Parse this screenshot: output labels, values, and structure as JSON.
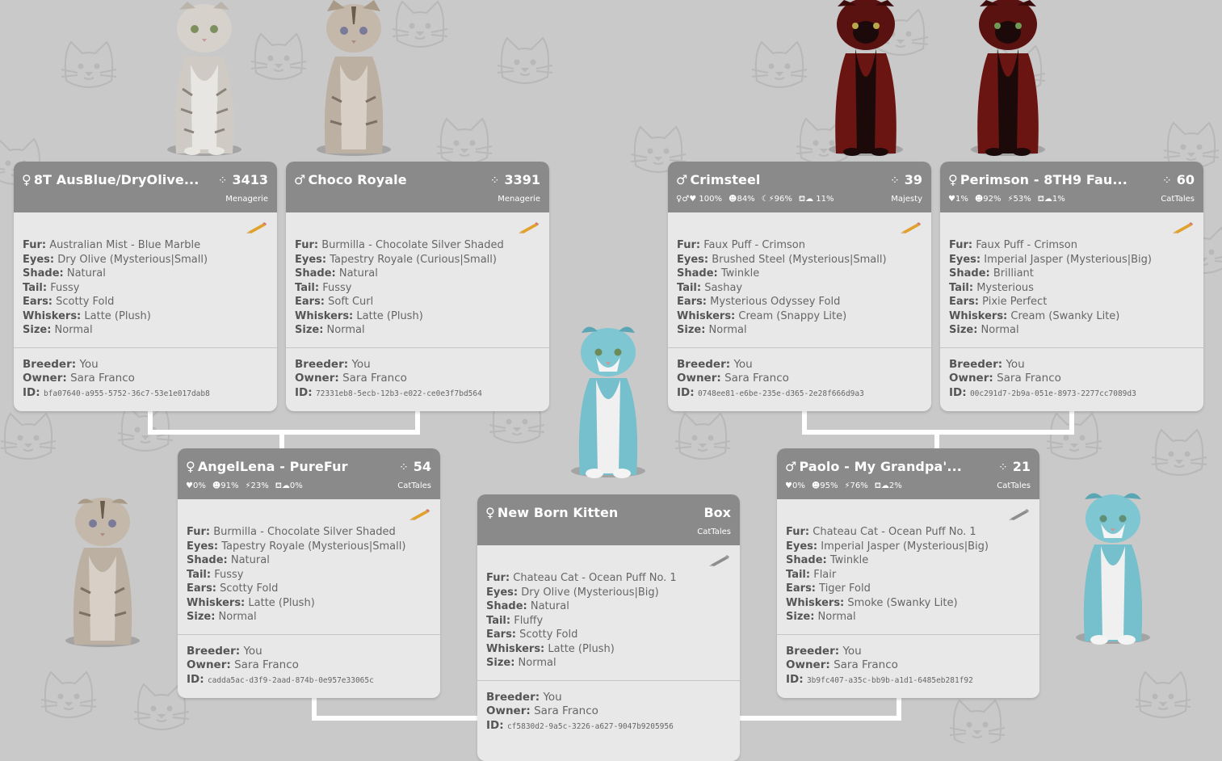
{
  "cards": {
    "ausblue": {
      "symbol": "♀",
      "name": "8T AusBlue/DryOlive...",
      "count": "3413",
      "source": "Menagerie",
      "fur": "Australian Mist - Blue Marble",
      "eyes": "Dry Olive (Mysterious|Small)",
      "shade": "Natural",
      "tail": "Fussy",
      "ears": "Scotty Fold",
      "whiskers": "Latte (Plush)",
      "size": "Normal",
      "breeder": "You",
      "owner": "Sara Franco",
      "id": "bfa07640-a955-5752-36c7-53e1e017dab8"
    },
    "choco": {
      "symbol": "♂",
      "name": "Choco Royale",
      "count": "3391",
      "source": "Menagerie",
      "fur": "Burmilla - Chocolate Silver Shaded",
      "eyes": "Tapestry Royale (Curious|Small)",
      "shade": "Natural",
      "tail": "Fussy",
      "ears": "Soft Curl",
      "whiskers": "Latte (Plush)",
      "size": "Normal",
      "breeder": "You",
      "owner": "Sara Franco",
      "id": "72331eb8-5ecb-12b3-e022-ce0e3f7bd564"
    },
    "crimsteel": {
      "symbol": "♂",
      "name": "Crimsteel",
      "count": "39",
      "source": "Majesty",
      "stats": [
        "♀♂♥ 100%",
        "☻84%",
        "☾⚡96%",
        "⛾☁ 11%"
      ],
      "fur": "Faux Puff - Crimson",
      "eyes": "Brushed Steel (Mysterious|Small)",
      "shade": "Twinkle",
      "tail": "Sashay",
      "ears": "Mysterious Odyssey Fold",
      "whiskers": "Cream (Snappy Lite)",
      "size": "Normal",
      "breeder": "You",
      "owner": "Sara Franco",
      "id": "0748ee81-e6be-235e-d365-2e28f666d9a3"
    },
    "perimson": {
      "symbol": "♀",
      "name": "Perimson - 8TH9 Fau...",
      "count": "60",
      "source": "CatTales",
      "stats": [
        "♥1%",
        "☻92%",
        "⚡53%",
        "⛾☁1%"
      ],
      "fur": "Faux Puff - Crimson",
      "eyes": "Imperial Jasper (Mysterious|Big)",
      "shade": "Brilliant",
      "tail": "Mysterious",
      "ears": "Pixie Perfect",
      "whiskers": "Cream (Swanky Lite)",
      "size": "Normal",
      "breeder": "You",
      "owner": "Sara Franco",
      "id": "00c291d7-2b9a-051e-8973-2277cc7089d3"
    },
    "angellena": {
      "symbol": "♀",
      "name": "AngelLena - PureFur",
      "count": "54",
      "source": "CatTales",
      "stats": [
        "♥0%",
        "☻91%",
        "⚡23%",
        "⛾☁0%"
      ],
      "fur": "Burmilla - Chocolate Silver Shaded",
      "eyes": "Tapestry Royale (Mysterious|Small)",
      "shade": "Natural",
      "tail": "Fussy",
      "ears": "Scotty Fold",
      "whiskers": "Latte (Plush)",
      "size": "Normal",
      "breeder": "You",
      "owner": "Sara Franco",
      "id": "cadda5ac-d3f9-2aad-874b-0e957e33065c"
    },
    "paolo": {
      "symbol": "♂",
      "name": "Paolo - My Grandpa'...",
      "count": "21",
      "source": "CatTales",
      "stats": [
        "♥0%",
        "☻95%",
        "⚡76%",
        "⛾☁2%"
      ],
      "fur": "Chateau Cat - Ocean Puff No. 1",
      "eyes": "Imperial Jasper (Mysterious|Big)",
      "shade": "Twinkle",
      "tail": "Flair",
      "ears": "Tiger Fold",
      "whiskers": "Smoke (Swanky Lite)",
      "size": "Normal",
      "breeder": "You",
      "owner": "Sara Franco",
      "id": "3b9fc407-a35c-bb9b-a1d1-6485eb281f92"
    },
    "kitten": {
      "symbol": "♀",
      "name": "New Born Kitten",
      "count": "Box",
      "source": "CatTales",
      "fur": "Chateau Cat - Ocean Puff No. 1",
      "eyes": "Dry Olive (Mysterious|Big)",
      "shade": "Natural",
      "tail": "Fluffy",
      "ears": "Scotty Fold",
      "whiskers": "Latte (Plush)",
      "size": "Normal",
      "breeder": "You",
      "owner": "Sara Franco",
      "id": "cf5830d2-9a5c-3226-a627-9047b9205956"
    }
  },
  "field_labels": {
    "fur": "Fur:",
    "eyes": "Eyes:",
    "shade": "Shade:",
    "tail": "Tail:",
    "ears": "Ears:",
    "whiskers": "Whiskers:",
    "size": "Size:",
    "breeder": "Breeder:",
    "owner": "Owner:",
    "id": "ID:"
  },
  "cat_colors": {
    "silver_tabby": "#cfcbc4",
    "choco_silver": "#bcb0a2",
    "crimson": "#6a1512",
    "ocean_blue": "#76bfcc"
  }
}
